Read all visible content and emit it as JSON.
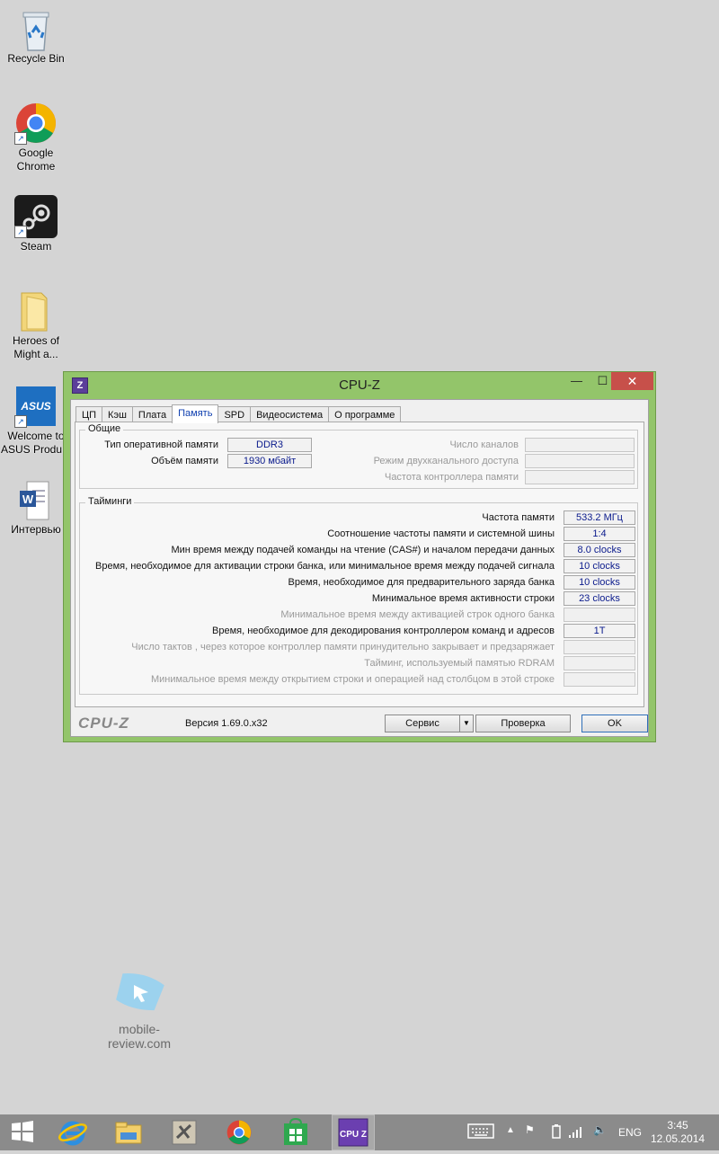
{
  "desktop": {
    "icons": [
      {
        "label_line1": "Recycle Bin",
        "label_line2": ""
      },
      {
        "label_line1": "Google",
        "label_line2": "Chrome"
      },
      {
        "label_line1": "Steam",
        "label_line2": ""
      },
      {
        "label_line1": "Heroes of",
        "label_line2": "Might a..."
      },
      {
        "label_line1": "Welcome to",
        "label_line2": "ASUS Produ..."
      },
      {
        "label_line1": "Интервью",
        "label_line2": ""
      }
    ],
    "watermark": "mobile-review.com"
  },
  "window": {
    "title": "CPU-Z",
    "icon_letter": "Z",
    "tabs": [
      "ЦП",
      "Кэш",
      "Плата",
      "Память",
      "SPD",
      "Видеосистема",
      "О программе"
    ],
    "active_tab": "Память",
    "general": {
      "legend": "Общие",
      "type_label": "Тип оперативной памяти",
      "type_value": "DDR3",
      "size_label": "Объём памяти",
      "size_value": "1930 мбайт",
      "channels_label": "Число каналов",
      "dual_label": "Режим двухканального доступа",
      "nb_freq_label": "Частота контроллера памяти"
    },
    "timings": {
      "legend": "Тайминги",
      "rows": [
        {
          "label": "Частота памяти",
          "value": "533.2 МГц",
          "dim": false
        },
        {
          "label": "Соотношение частоты памяти и системной шины",
          "value": "1:4",
          "dim": false
        },
        {
          "label": "Мин время между подачей команды на чтение (CAS#) и началом передачи данных",
          "value": "8.0 clocks",
          "dim": false
        },
        {
          "label": "Время, необходимое для активации строки банка, или минимальное время между подачей сигнала",
          "value": "10 clocks",
          "dim": false
        },
        {
          "label": "Время, необходимое для предварительного заряда банка",
          "value": "10 clocks",
          "dim": false
        },
        {
          "label": "Минимальное время активности строки",
          "value": "23 clocks",
          "dim": false
        },
        {
          "label": "Минимальное время между активацией строк одного банка",
          "value": "",
          "dim": true
        },
        {
          "label": "Время, необходимое для декодирования контроллером команд и адресов",
          "value": "1T",
          "dim": false
        },
        {
          "label": "Число тактов , через которое контроллер памяти принудительно закрывает и предзаряжает",
          "value": "",
          "dim": true
        },
        {
          "label": "Тайминг, используемый памятью RDRAM",
          "value": "",
          "dim": true
        },
        {
          "label": "Минимальное время между открытием строки и операцией над столбцом в этой строке",
          "value": "",
          "dim": true
        }
      ]
    },
    "footer": {
      "logo": "CPU-Z",
      "version": "Версия 1.69.0.x32",
      "service_btn": "Сервис",
      "validate_btn": "Проверка",
      "ok_btn": "OK"
    }
  },
  "taskbar": {
    "language": "ENG",
    "time": "3:45",
    "date": "12.05.2014",
    "active_app_label": "CPU Z"
  },
  "colors": {
    "desktop": "#d4d4d4",
    "window_frame": "#93c56a",
    "close_button": "#c7504a",
    "taskbar": "#8b8b8b",
    "value_text": "#0a1a8c"
  }
}
